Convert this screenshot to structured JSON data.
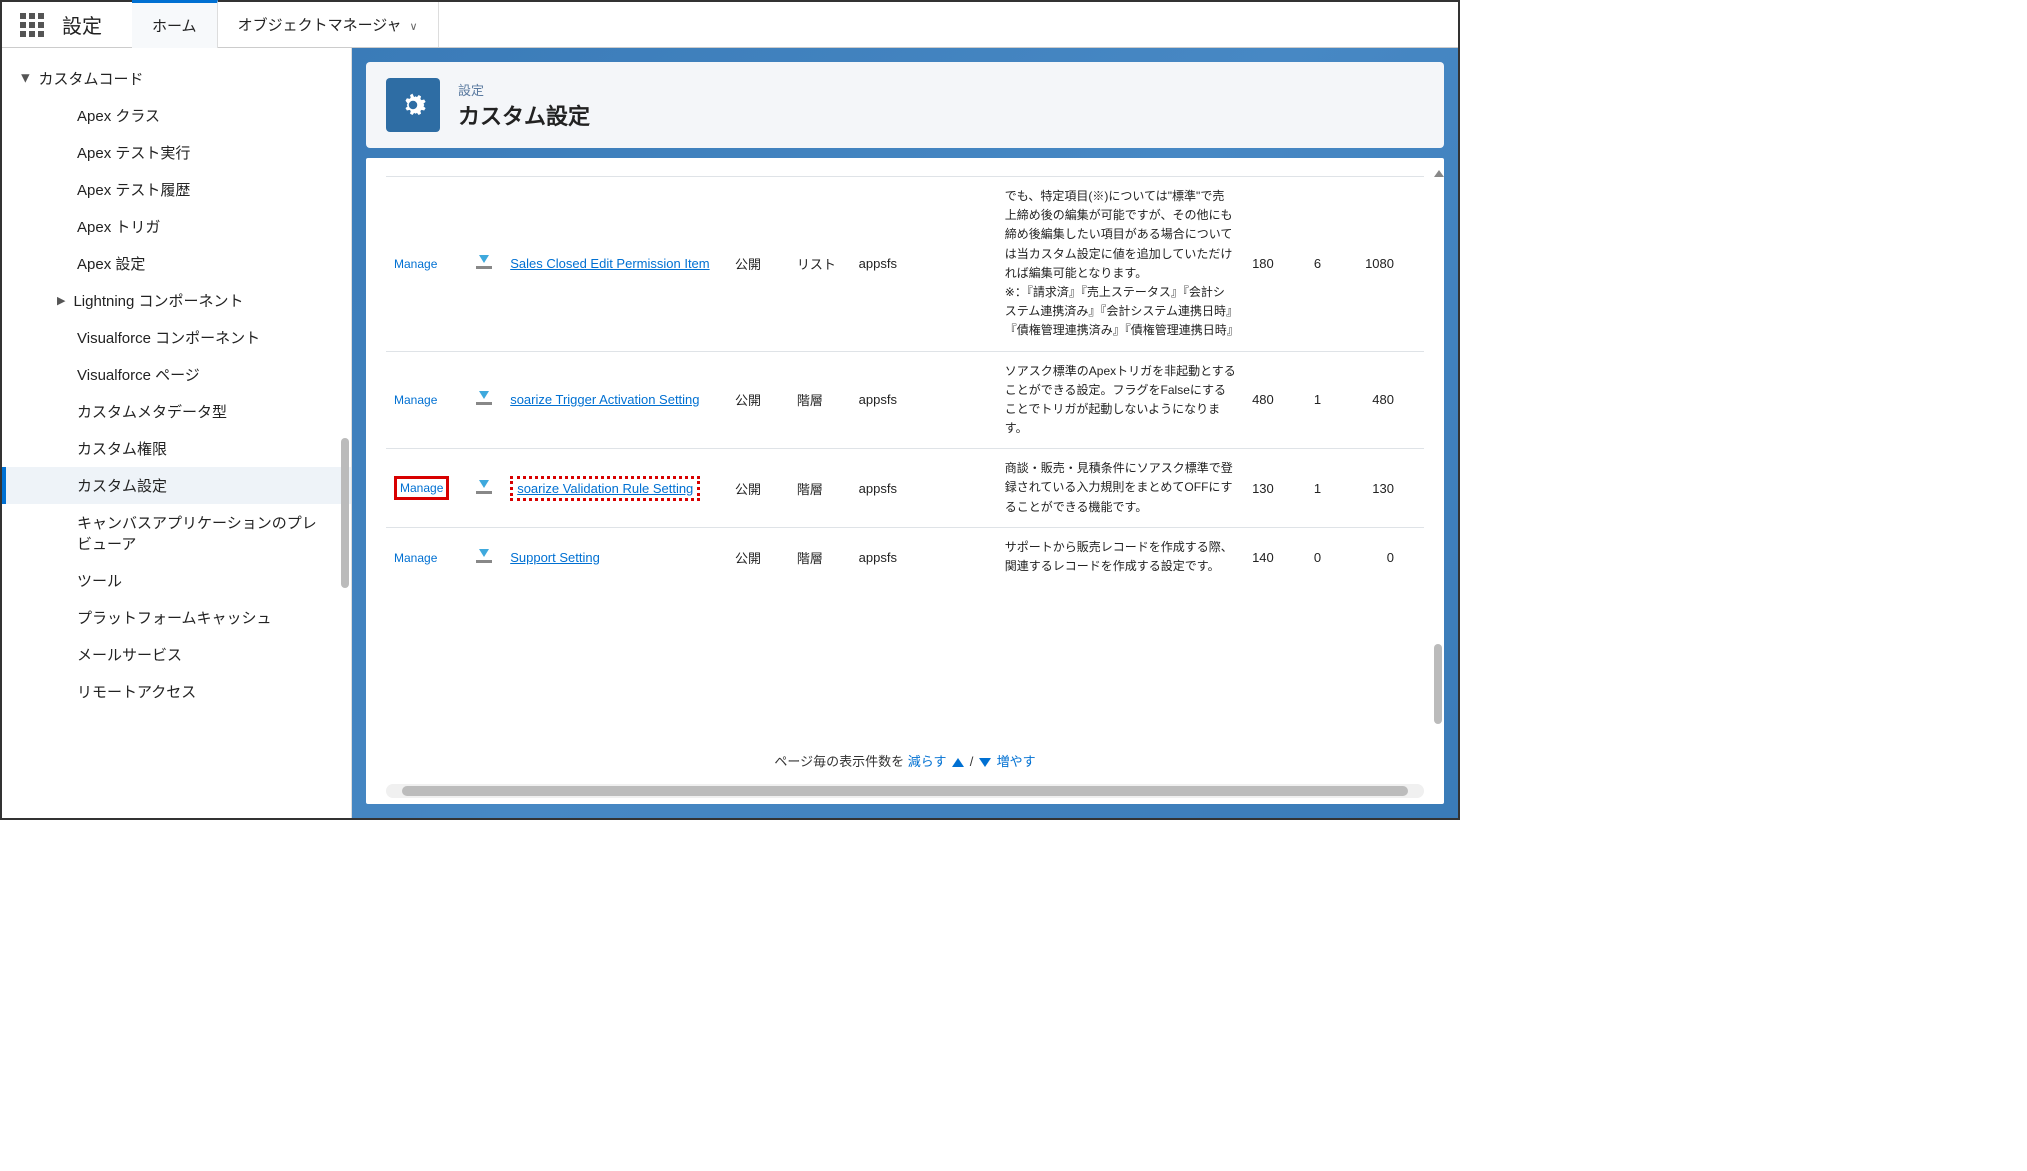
{
  "topbar": {
    "app_title": "設定",
    "tabs": [
      {
        "label": "ホーム",
        "active": true
      },
      {
        "label": "オブジェクトマネージャ",
        "dropdown": true
      }
    ]
  },
  "sidebar": {
    "parent": "カスタムコード",
    "items": [
      {
        "label": "Apex クラス"
      },
      {
        "label": "Apex テスト実行"
      },
      {
        "label": "Apex テスト履歴"
      },
      {
        "label": "Apex トリガ"
      },
      {
        "label": "Apex 設定"
      },
      {
        "label": "Lightning コンポーネント",
        "expandable": true
      },
      {
        "label": "Visualforce コンポーネント"
      },
      {
        "label": "Visualforce ページ"
      },
      {
        "label": "カスタムメタデータ型"
      },
      {
        "label": "カスタム権限"
      },
      {
        "label": "カスタム設定",
        "selected": true
      },
      {
        "label": "キャンバスアプリケーションのプレビューア"
      },
      {
        "label": "ツール"
      },
      {
        "label": "プラットフォームキャッシュ"
      },
      {
        "label": "メールサービス"
      },
      {
        "label": "リモートアクセス"
      }
    ]
  },
  "page_header": {
    "crumb": "設定",
    "title": "カスタム設定"
  },
  "rows": [
    {
      "action": "Manage",
      "name": "Sales Closed Edit Permission Item",
      "visibility": "公開",
      "type": "リスト",
      "ns": "appsfs",
      "desc": "でも、特定項目(※)については\"標準\"で売上締め後の編集が可能ですが、その他にも締め後編集したい項目がある場合については当カスタム設定に値を追加していただければ編集可能となります。\n※：『請求済』『売上ステータス』『会計システム連携済み』『会計システム連携日時』『債権管理連携済み』『債権管理連携日時』",
      "c1": "180",
      "c2": "6",
      "c3": "1080"
    },
    {
      "action": "Manage",
      "name": "soarize Trigger Activation Setting",
      "visibility": "公開",
      "type": "階層",
      "ns": "appsfs",
      "desc": "ソアスク標準のApexトリガを非起動とすることができる設定。フラグをFalseにすることでトリガが起動しないようになります。",
      "c1": "480",
      "c2": "1",
      "c3": "480"
    },
    {
      "action": "Manage",
      "highlight": true,
      "name": "soarize Validation Rule Setting",
      "visibility": "公開",
      "type": "階層",
      "ns": "appsfs",
      "desc": "商談・販売・見積条件にソアスク標準で登録されている入力規則をまとめてOFFにすることができる機能です。",
      "c1": "130",
      "c2": "1",
      "c3": "130"
    },
    {
      "action": "Manage",
      "name": "Support Setting",
      "visibility": "公開",
      "type": "階層",
      "ns": "appsfs",
      "desc": "サポートから販売レコードを作成する際、関連するレコードを作成する設定です。",
      "c1": "140",
      "c2": "0",
      "c3": "0"
    }
  ],
  "pager": {
    "prefix": "ページ毎の表示件数を ",
    "less": "減らす",
    "sep": " / ",
    "more": "増やす"
  }
}
